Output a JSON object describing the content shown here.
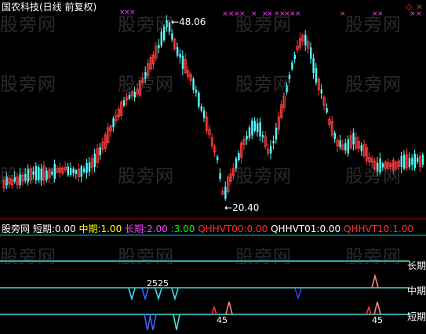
{
  "window": {
    "title": "国农科技(日线 前复权)",
    "controls": [
      "◇",
      "×"
    ]
  },
  "watermarks": [
    "股旁网",
    "股旁网",
    "股旁网",
    "股旁网",
    "股旁网",
    "股旁网",
    "股旁网",
    "股旁网",
    "股旁网",
    "股旁网",
    "股旁网",
    "股旁网",
    "股旁网",
    "股旁网",
    "股旁网",
    "股旁网"
  ],
  "main_chart": {
    "high_label": "48.06",
    "low_label": "20.40",
    "high_arrow": "←",
    "low_arrow": "←"
  },
  "indicator_bar": {
    "name": "股旁网",
    "items": [
      {
        "label": "短期:",
        "value": "0.00",
        "color": "#ffffff"
      },
      {
        "label": "中期:",
        "value": "1.00",
        "color": "#ffff00"
      },
      {
        "label": "长期:",
        "value": "2.00",
        "color": "#ff40ff"
      },
      {
        "label": ":",
        "value": "3.00",
        "color": "#00ff00"
      },
      {
        "label": "QHHVT00:",
        "value": "0.00",
        "color": "#ff3030"
      },
      {
        "label": "QHHVT01:",
        "value": "0.00",
        "color": "#ffffff"
      },
      {
        "label": "QHHVT10:",
        "value": "1.00",
        "color": "#ff3030"
      }
    ]
  },
  "levels": [
    "长期",
    "中期",
    "短期"
  ],
  "signal_labels": [
    "2525",
    "45",
    "45"
  ],
  "colors": {
    "up": "#ff3c3c",
    "down": "#54ffff",
    "magenta": "#ff40ff",
    "cyan_line": "#40e0e0"
  }
}
